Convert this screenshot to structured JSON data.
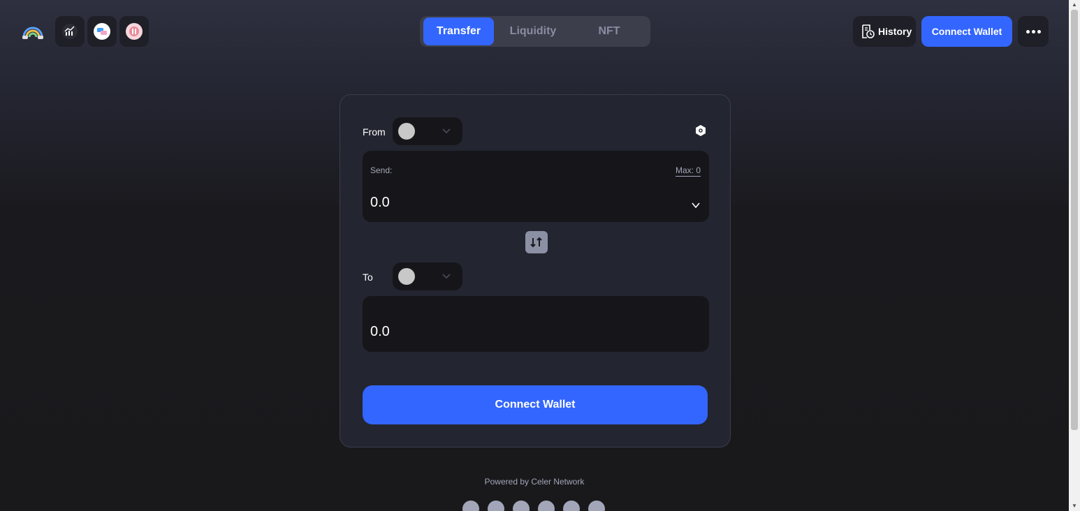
{
  "header": {
    "logo_icon": "rainbow-logo-icon",
    "app_icons": [
      "analytics-icon",
      "app-two-icon",
      "app-three-icon"
    ],
    "tabs": [
      {
        "label": "Transfer",
        "active": true
      },
      {
        "label": "Liquidity",
        "active": false
      },
      {
        "label": "NFT",
        "active": false
      }
    ],
    "history_label": "History",
    "connect_label": "Connect Wallet",
    "more_icon": "more-dots-icon"
  },
  "transfer": {
    "from_label": "From",
    "to_label": "To",
    "send_label": "Send:",
    "max_label": "Max: 0",
    "send_amount": "0.0",
    "receive_amount": "0.0",
    "connect_label": "Connect Wallet"
  },
  "footer": {
    "powered_by": "Powered by Celer Network",
    "social_icons": [
      "home-icon",
      "docs-icon",
      "medium-icon",
      "telegram-icon",
      "twitter-icon",
      "github-icon"
    ]
  },
  "colors": {
    "accent": "#3366ff",
    "card_bg": "#232530",
    "input_bg": "#16161a"
  }
}
